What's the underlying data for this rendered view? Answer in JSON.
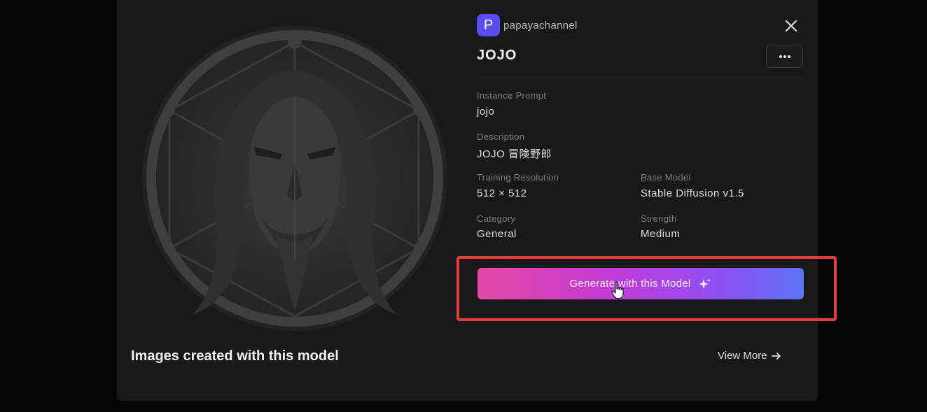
{
  "creator": {
    "badge_letter": "P",
    "name": "papayachannel"
  },
  "model": {
    "title": "JOJO",
    "fields": {
      "instance_prompt": {
        "label": "Instance Prompt",
        "value": "jojo"
      },
      "description": {
        "label": "Description",
        "value": "JOJO 冒険野郎"
      },
      "training_resolution": {
        "label": "Training Resolution",
        "value": "512 × 512"
      },
      "base_model": {
        "label": "Base Model",
        "value": "Stable Diffusion v1.5"
      },
      "category": {
        "label": "Category",
        "value": "General"
      },
      "strength": {
        "label": "Strength",
        "value": "Medium"
      }
    }
  },
  "actions": {
    "generate_label": "Generate with this Model"
  },
  "gallery": {
    "heading": "Images created with this model",
    "view_more_label": "View More"
  },
  "icons": {
    "close": "close-icon",
    "more": "more-horizontal-icon",
    "sparkle": "sparkle-icon",
    "arrow": "arrow-right-icon",
    "cursor": "hand-cursor-icon"
  },
  "colors": {
    "badge": "#5b4bf0",
    "button_gradient_start": "#e54aa3",
    "button_gradient_end": "#5c74f5",
    "highlight": "#e0403a",
    "modal_bg": "#19191b"
  }
}
